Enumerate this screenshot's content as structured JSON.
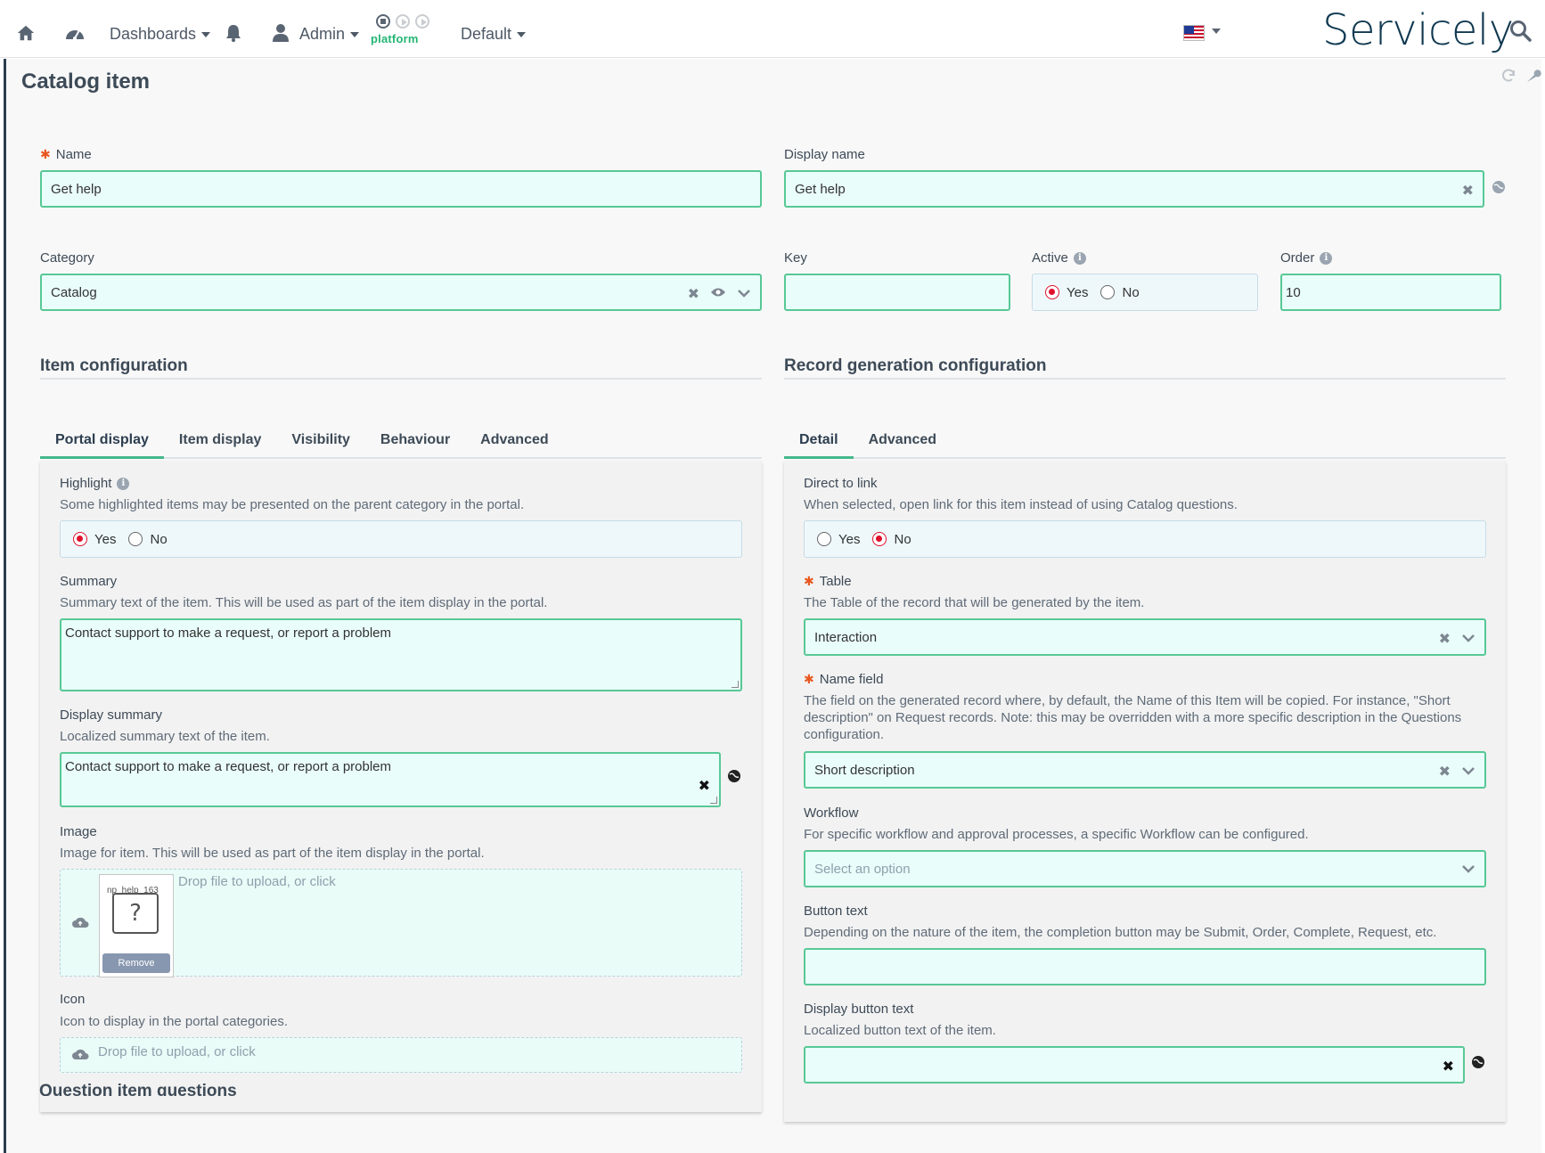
{
  "nav": {
    "dashboards": "Dashboards",
    "admin": "Admin",
    "platform": "platform",
    "default": "Default",
    "brand": "Servicely"
  },
  "page": {
    "title": "Catalog item"
  },
  "form": {
    "name": {
      "label": "Name",
      "value": "Get help"
    },
    "display_name": {
      "label": "Display name",
      "value": "Get help"
    },
    "category": {
      "label": "Category",
      "value": "Catalog"
    },
    "key": {
      "label": "Key",
      "value": ""
    },
    "active": {
      "label": "Active",
      "yes": "Yes",
      "no": "No",
      "selected": "Yes"
    },
    "order": {
      "label": "Order",
      "value": "10"
    }
  },
  "item_config": {
    "title": "Item configuration",
    "tabs": [
      "Portal display",
      "Item display",
      "Visibility",
      "Behaviour",
      "Advanced"
    ],
    "highlight": {
      "label": "Highlight",
      "hint": "Some highlighted items may be presented on the parent category in the portal.",
      "yes": "Yes",
      "no": "No",
      "selected": "Yes"
    },
    "summary": {
      "label": "Summary",
      "hint": "Summary text of the item. This will be used as part of the item display in the portal.",
      "value": "Contact support to make a request, or report a problem"
    },
    "display_summary": {
      "label": "Display summary",
      "hint": "Localized summary text of the item.",
      "value": "Contact support to make a request, or report a problem"
    },
    "image": {
      "label": "Image",
      "hint": "Image for item. This will be used as part of the item display in the portal.",
      "drop": "Drop file to upload, or click",
      "file_name": "np_help_163",
      "remove": "Remove"
    },
    "icon": {
      "label": "Icon",
      "hint": "Icon to display in the portal categories.",
      "drop": "Drop file to upload, or click"
    }
  },
  "record_config": {
    "title": "Record generation configuration",
    "tabs": [
      "Detail",
      "Advanced"
    ],
    "direct_link": {
      "label": "Direct to link",
      "hint": "When selected, open link for this item instead of using Catalog questions.",
      "yes": "Yes",
      "no": "No",
      "selected": "No"
    },
    "table": {
      "label": "Table",
      "hint": "The Table of the record that will be generated by the item.",
      "value": "Interaction"
    },
    "name_field": {
      "label": "Name field",
      "hint": "The field on the generated record where, by default, the Name of this Item will be copied. For instance, \"Short description\" on Request records. Note: this may be overridden with a more specific description in the Questions configuration.",
      "value": "Short description"
    },
    "workflow": {
      "label": "Workflow",
      "hint": "For specific workflow and approval processes, a specific Workflow can be configured.",
      "placeholder": "Select an option"
    },
    "button_text": {
      "label": "Button text",
      "hint": "Depending on the nature of the item, the completion button may be Submit, Order, Complete, Request, etc.",
      "value": ""
    },
    "display_button_text": {
      "label": "Display button text",
      "hint": "Localized button text of the item.",
      "value": ""
    }
  },
  "bottom": {
    "section_title": "Question item questions"
  },
  "colors": {
    "accent": "#58c896",
    "required": "#e8571e",
    "radio_selected": "#e0102d",
    "brand": "#0f3850"
  }
}
